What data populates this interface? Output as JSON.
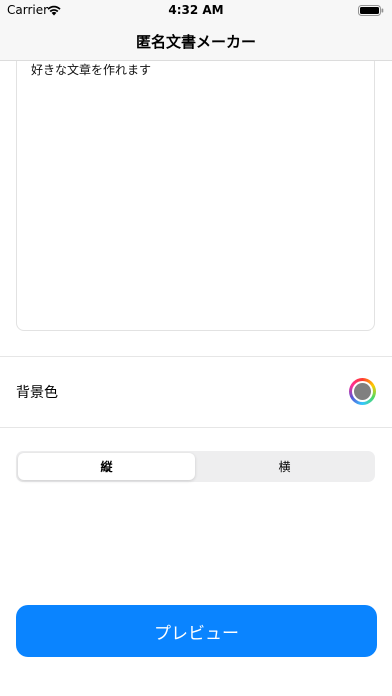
{
  "status_bar": {
    "carrier": "Carrier",
    "time": "4:32 AM"
  },
  "nav": {
    "title": "匿名文書メーカー"
  },
  "editor": {
    "text": "好きな文章を作れます"
  },
  "background_color": {
    "label": "背景色",
    "current_color": "#808080"
  },
  "orientation": {
    "options": [
      "縦",
      "横"
    ],
    "selected": "縦"
  },
  "preview_button": {
    "label": "プレビュー",
    "color": "#0a84ff"
  },
  "icons": [
    "wifi-icon",
    "battery-icon"
  ]
}
